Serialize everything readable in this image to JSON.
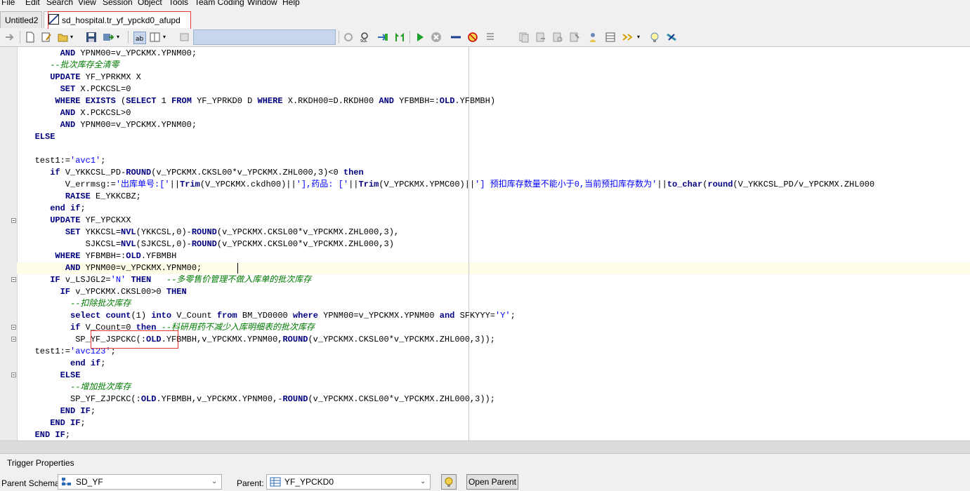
{
  "menu": [
    "File",
    "Edit",
    "Search",
    "View",
    "Session",
    "Object",
    "Tools",
    "Team Coding",
    "Window",
    "Help"
  ],
  "tabs": [
    {
      "label": "Untitled2",
      "active": false
    },
    {
      "label": "sd_hospital.tr_yf_ypckd0_afupd",
      "active": true
    }
  ],
  "toolbar": {
    "icons": [
      "nav-arrow-icon",
      "new-file-icon",
      "edit-icon",
      "open-folder-icon",
      "save-icon",
      "save-as-icon",
      "format-icon",
      "split-view-icon",
      "compile-icon",
      "refresh-icon",
      "sql-icon",
      "explain-icon",
      "describe-icon",
      "run-icon",
      "stop-icon",
      "step-icon",
      "debug-icon",
      "list-icon",
      "copy-icon",
      "paste-icon",
      "find-icon",
      "replace-icon",
      "user-icon",
      "grid-icon",
      "arrows-icon",
      "bulb-icon",
      "db-icon"
    ]
  },
  "code_lines": [
    [
      [
        "        ",
        ""
      ],
      [
        "AND",
        "kb"
      ],
      [
        " YPNM00=v_YPCKMX.YPNM00;",
        ""
      ]
    ],
    [
      [
        "      ",
        ""
      ],
      [
        "--批次库存全清零",
        "cm"
      ]
    ],
    [
      [
        "      ",
        ""
      ],
      [
        "UPDATE",
        "kb"
      ],
      [
        " YF_YPRKMX X",
        ""
      ]
    ],
    [
      [
        "        ",
        ""
      ],
      [
        "SET",
        "kb"
      ],
      [
        " X.PCKCSL=0",
        ""
      ]
    ],
    [
      [
        "       ",
        ""
      ],
      [
        "WHERE",
        "kb"
      ],
      [
        " ",
        ""
      ],
      [
        "EXISTS",
        "kb"
      ],
      [
        " (",
        ""
      ],
      [
        "SELECT",
        "kb"
      ],
      [
        " 1 ",
        ""
      ],
      [
        "FROM",
        "kb"
      ],
      [
        " YF_YPRKD0 D ",
        ""
      ],
      [
        "WHERE",
        "kb"
      ],
      [
        " X.RKDH00=D.RKDH00 ",
        ""
      ],
      [
        "AND",
        "kb"
      ],
      [
        " YFBMBH=:",
        ""
      ],
      [
        "OLD",
        "kb"
      ],
      [
        ".YFBMBH)",
        ""
      ]
    ],
    [
      [
        "        ",
        ""
      ],
      [
        "AND",
        "kb"
      ],
      [
        " X.PCKCSL>0",
        ""
      ]
    ],
    [
      [
        "        ",
        ""
      ],
      [
        "AND",
        "kb"
      ],
      [
        " YPNM00=v_YPCKMX.YPNM00;",
        ""
      ]
    ],
    [
      [
        "   ",
        ""
      ],
      [
        "ELSE",
        "kb"
      ]
    ],
    [
      [
        "",
        ""
      ]
    ],
    [
      [
        "   test1:=",
        ""
      ],
      [
        "'avc1'",
        "str"
      ],
      [
        ";",
        ""
      ]
    ],
    [
      [
        "      ",
        ""
      ],
      [
        "if",
        "kb"
      ],
      [
        " V_YKKCSL_PD-",
        ""
      ],
      [
        "ROUND",
        "fn"
      ],
      [
        "(v_YPCKMX.CKSL00*v_YPCKMX.ZHL000,3)<0 ",
        ""
      ],
      [
        "then",
        "kb"
      ]
    ],
    [
      [
        "         V_errmsg:=",
        ""
      ],
      [
        "'出库单号:['",
        "str"
      ],
      [
        "||",
        ""
      ],
      [
        "Trim",
        "fn"
      ],
      [
        "(V_YPCKMX.ckdh00)||",
        ""
      ],
      [
        "'],药品: ['",
        "str"
      ],
      [
        "||",
        ""
      ],
      [
        "Trim",
        "fn"
      ],
      [
        "(V_YPCKMX.YPMC00)||",
        ""
      ],
      [
        "'] 预扣库存数量不能小于0,当前预扣库存数为'",
        "str"
      ],
      [
        "||",
        ""
      ],
      [
        "to_char",
        "fn"
      ],
      [
        "(",
        ""
      ],
      [
        "round",
        "fn"
      ],
      [
        "(V_YKKCSL_PD/v_YPCKMX.ZHL000",
        ""
      ]
    ],
    [
      [
        "         ",
        ""
      ],
      [
        "RAISE",
        "kb"
      ],
      [
        " E_YKKCBZ;",
        ""
      ]
    ],
    [
      [
        "      ",
        ""
      ],
      [
        "end if",
        "kb"
      ],
      [
        ";",
        ""
      ]
    ],
    [
      [
        "      ",
        ""
      ],
      [
        "UPDATE",
        "kb"
      ],
      [
        " YF_YPCKXX",
        ""
      ]
    ],
    [
      [
        "         ",
        ""
      ],
      [
        "SET",
        "kb"
      ],
      [
        " YKKCSL=",
        ""
      ],
      [
        "NVL",
        "fn"
      ],
      [
        "(YKKCSL,0)-",
        ""
      ],
      [
        "ROUND",
        "fn"
      ],
      [
        "(v_YPCKMX.CKSL00*v_YPCKMX.ZHL000,3),",
        ""
      ]
    ],
    [
      [
        "             SJKCSL=",
        ""
      ],
      [
        "NVL",
        "fn"
      ],
      [
        "(SJKCSL,0)-",
        ""
      ],
      [
        "ROUND",
        "fn"
      ],
      [
        "(v_YPCKMX.CKSL00*v_YPCKMX.ZHL000,3)",
        ""
      ]
    ],
    [
      [
        "       ",
        ""
      ],
      [
        "WHERE",
        "kb"
      ],
      [
        " YFBMBH=:",
        ""
      ],
      [
        "OLD",
        "kb"
      ],
      [
        ".YFBMBH",
        ""
      ]
    ],
    [
      [
        "         ",
        ""
      ],
      [
        "AND",
        "kb"
      ],
      [
        " YPNM00=v_YPCKMX.YPNM00;",
        ""
      ]
    ],
    [
      [
        "      ",
        ""
      ],
      [
        "IF",
        "kb"
      ],
      [
        " v_LSJGL2=",
        ""
      ],
      [
        "'N'",
        "str"
      ],
      [
        " ",
        ""
      ],
      [
        "THEN",
        "kb"
      ],
      [
        "   ",
        ""
      ],
      [
        "--多零售价管理不做入库单的批次库存",
        "cm"
      ]
    ],
    [
      [
        "        ",
        ""
      ],
      [
        "IF",
        "kb"
      ],
      [
        " v_YPCKMX.CKSL00>0 ",
        ""
      ],
      [
        "THEN",
        "kb"
      ]
    ],
    [
      [
        "          ",
        ""
      ],
      [
        "--扣除批次库存",
        "cm"
      ]
    ],
    [
      [
        "          ",
        ""
      ],
      [
        "select",
        "kb"
      ],
      [
        " ",
        ""
      ],
      [
        "count",
        "kb"
      ],
      [
        "(1) ",
        ""
      ],
      [
        "into",
        "kb"
      ],
      [
        " V_Count ",
        ""
      ],
      [
        "from",
        "kb"
      ],
      [
        " BM_YD0000 ",
        ""
      ],
      [
        "where",
        "kb"
      ],
      [
        " YPNM00=v_YPCKMX.YPNM00 ",
        ""
      ],
      [
        "and",
        "kb"
      ],
      [
        " SFKYYY=",
        ""
      ],
      [
        "'Y'",
        "str"
      ],
      [
        ";",
        ""
      ]
    ],
    [
      [
        "          ",
        ""
      ],
      [
        "if",
        "kb"
      ],
      [
        " V_Count=0 ",
        ""
      ],
      [
        "then",
        "kb"
      ],
      [
        " ",
        ""
      ],
      [
        "--科研用药不减少入库明细表的批次库存",
        "cm"
      ]
    ],
    [
      [
        "           SP_YF_JSPCKC(:",
        ""
      ],
      [
        "OLD",
        "kb"
      ],
      [
        ".YFBMBH,v_YPCKMX.YPNM00,",
        ""
      ],
      [
        "ROUND",
        "fn"
      ],
      [
        "(v_YPCKMX.CKSL00*v_YPCKMX.ZHL000,3));",
        ""
      ]
    ],
    [
      [
        "   test1:=",
        ""
      ],
      [
        "'avc123'",
        "str"
      ],
      [
        ";",
        ""
      ]
    ],
    [
      [
        "          ",
        ""
      ],
      [
        "end if",
        "kb"
      ],
      [
        ";",
        ""
      ]
    ],
    [
      [
        "        ",
        ""
      ],
      [
        "ELSE",
        "kb"
      ]
    ],
    [
      [
        "          ",
        ""
      ],
      [
        "--增加批次库存",
        "cm"
      ]
    ],
    [
      [
        "          SP_YF_ZJPCKC(:",
        ""
      ],
      [
        "OLD",
        "kb"
      ],
      [
        ".YFBMBH,v_YPCKMX.YPNM00,-",
        ""
      ],
      [
        "ROUND",
        "fn"
      ],
      [
        "(v_YPCKMX.CKSL00*v_YPCKMX.ZHL000,3));",
        ""
      ]
    ],
    [
      [
        "        ",
        ""
      ],
      [
        "END IF",
        "kb"
      ],
      [
        ";",
        ""
      ]
    ],
    [
      [
        "      ",
        ""
      ],
      [
        "END IF",
        "kb"
      ],
      [
        ";",
        ""
      ]
    ],
    [
      [
        "   ",
        ""
      ],
      [
        "END IF",
        "kb"
      ],
      [
        ";",
        ""
      ]
    ]
  ],
  "props": {
    "title": "Trigger Properties",
    "schema_label": "Parent Schema:",
    "schema_value": "SD_YF",
    "parent_label": "Parent:",
    "parent_value": "YF_YPCKD0",
    "open_parent": "Open Parent"
  }
}
